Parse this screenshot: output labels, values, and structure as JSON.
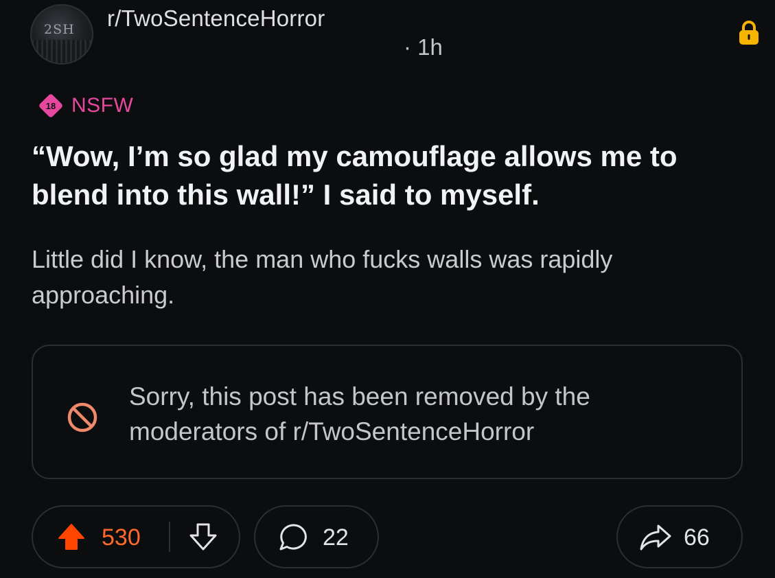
{
  "header": {
    "avatar_text": "2SH",
    "subreddit": "r/TwoSentenceHorror",
    "timestamp": "· 1h",
    "lock_icon": "lock-icon"
  },
  "tags": {
    "nsfw_badge_number": "18",
    "nsfw_label": "NSFW",
    "nsfw_color": "#e5489e"
  },
  "post": {
    "title": "“Wow, I’m so glad my camouflage allows me to blend into this wall!” I said to myself.",
    "body": "Little did I know, the man who fucks walls was rapidly approaching."
  },
  "removed_notice": {
    "icon": "prohibited-icon",
    "text": "Sorry, this post has been removed by the moderators of r/TwoSentenceHorror"
  },
  "actions": {
    "upvote_count": "530",
    "comment_count": "22",
    "share_count": "66",
    "upvote_color": "#ff4500"
  }
}
